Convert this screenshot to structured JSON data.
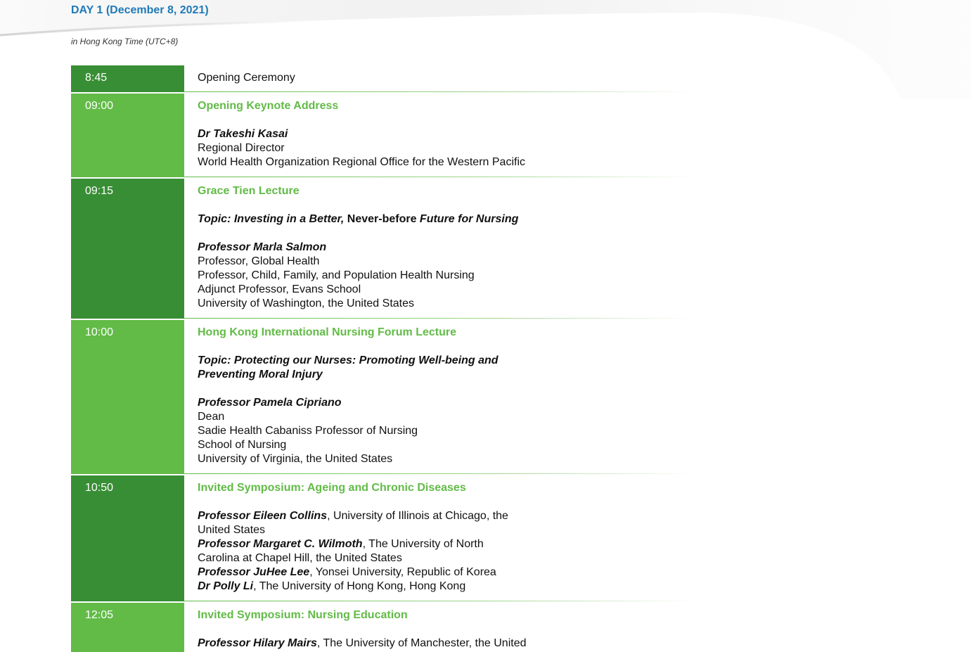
{
  "header": {
    "day_title": "DAY 1 (December 8, 2021)",
    "timezone": "in Hong Kong Time (UTC+8)"
  },
  "colors": {
    "dark_green": "#388e34",
    "light_green": "#62bb47",
    "title_blue": "#1f7ab8"
  },
  "sessions": [
    {
      "time": "8:45",
      "title": "Opening Ceremony"
    },
    {
      "time": "09:00",
      "title": "Opening Keynote Address",
      "speaker": "Dr Takeshi Kasai",
      "details": [
        "Regional Director",
        "World Health Organization Regional Office for the Western Pacific"
      ]
    },
    {
      "time": "09:15",
      "title": "Grace Tien Lecture",
      "topic_a": "Topic: Investing in a Better,",
      "topic_b": " Never-before ",
      "topic_c": "Future for Nursing",
      "speaker": "Professor Marla Salmon",
      "details": [
        "Professor, Global Health",
        "Professor, Child, Family, and Population Health Nursing",
        "Adjunct Professor, Evans School",
        "University of Washington, the United States"
      ]
    },
    {
      "time": "10:00",
      "title": "Hong Kong International Nursing Forum Lecture",
      "topic_line1": "Topic: Protecting our Nurses: Promoting Well-being and",
      "topic_line2": "Preventing Moral Injury",
      "speaker": "Professor Pamela Cipriano",
      "details": [
        "Dean",
        "Sadie Health Cabaniss Professor of Nursing",
        "School of Nursing",
        "University of Virginia, the United States"
      ]
    },
    {
      "time": "10:50",
      "title": "Invited Symposium: Ageing and Chronic Diseases",
      "speakers": [
        {
          "name": "Professor Eileen Collins",
          "aff1": ", University of Illinois at Chicago, the",
          "aff2": "United States"
        },
        {
          "name": "Professor Margaret C. Wilmoth",
          "aff1": ", The University of North",
          "aff2": "Carolina at Chapel Hill, the United States"
        },
        {
          "name": "Professor JuHee Lee",
          "aff1": ", Yonsei University, Republic of Korea",
          "aff2": ""
        },
        {
          "name": "Dr Polly Li",
          "aff1": ", The University of Hong Kong, Hong Kong",
          "aff2": ""
        }
      ]
    },
    {
      "time": "12:05",
      "title": "Invited Symposium: Nursing Education",
      "speakers": [
        {
          "name": "Professor Hilary Mairs",
          "aff1": ", The University of Manchester, the United",
          "aff2": ""
        }
      ]
    }
  ]
}
